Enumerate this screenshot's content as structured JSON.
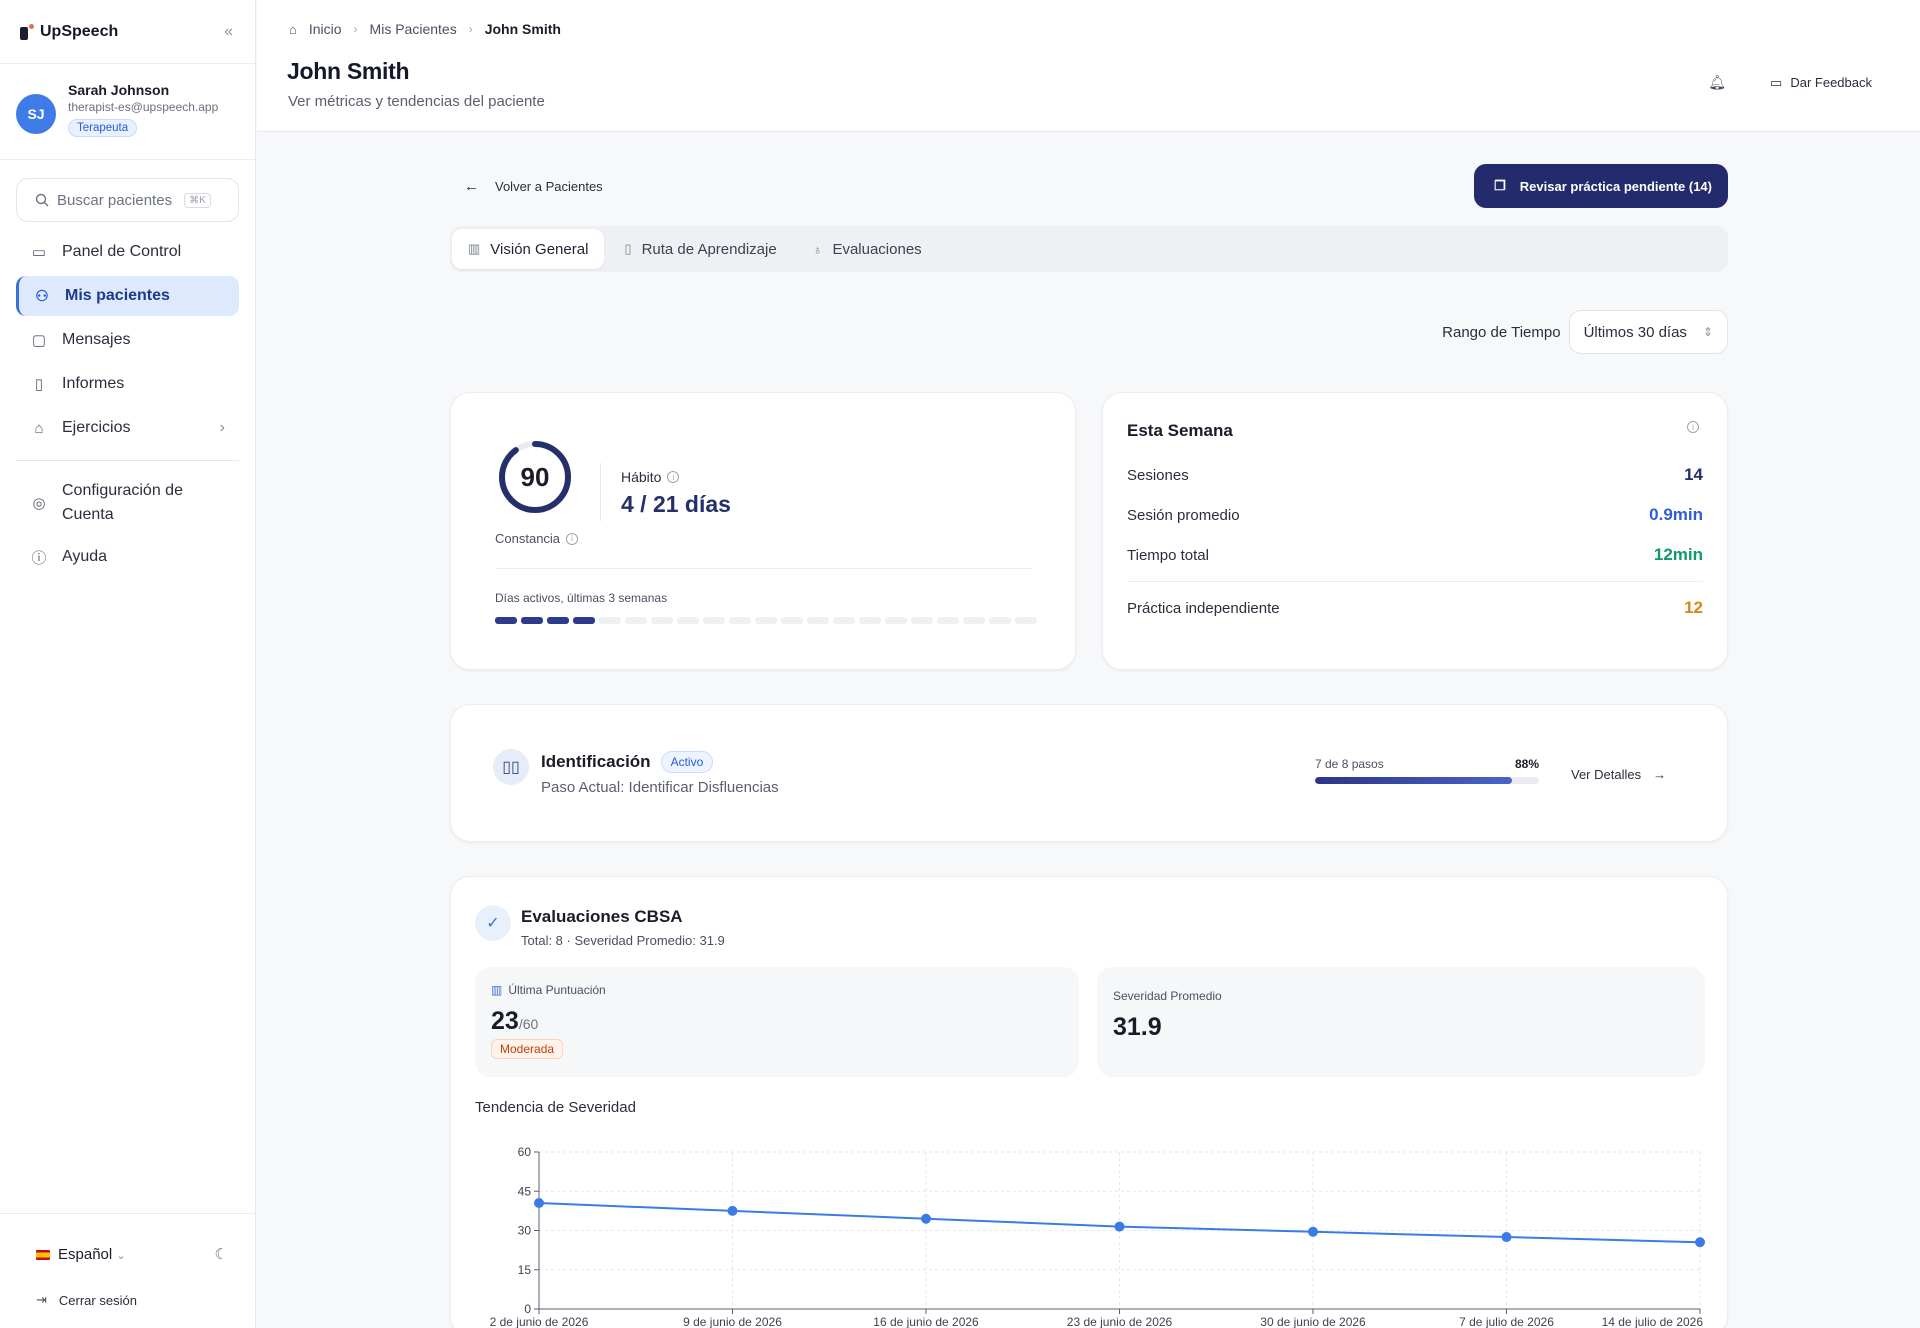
{
  "app": {
    "name": "UpSpeech"
  },
  "user": {
    "initials": "SJ",
    "name": "Sarah Johnson",
    "email": "therapist-es@upspeech.app",
    "role": "Terapeuta"
  },
  "search": {
    "placeholder": "Buscar pacientes",
    "shortcut": "⌘K"
  },
  "sidebar": {
    "items": [
      {
        "label": "Panel de Control",
        "icon": "dashboard-icon"
      },
      {
        "label": "Mis pacientes",
        "icon": "users-icon"
      },
      {
        "label": "Mensajes",
        "icon": "messages-icon"
      },
      {
        "label": "Informes",
        "icon": "report-icon"
      },
      {
        "label": "Ejercicios",
        "icon": "graduation-icon"
      }
    ],
    "secondary": [
      {
        "label": "Configuración de Cuenta",
        "icon": "user-circle-icon"
      },
      {
        "label": "Ayuda",
        "icon": "help-icon"
      }
    ],
    "language": "Español",
    "logout": "Cerrar sesión"
  },
  "header": {
    "breadcrumb": [
      "Inicio",
      "Mis Pacientes",
      "John Smith"
    ],
    "title": "John Smith",
    "subtitle": "Ver métricas y tendencias del paciente",
    "feedback": "Dar Feedback"
  },
  "main": {
    "back": "Volver a Pacientes",
    "review_button": "Revisar práctica pendiente (14)",
    "tabs": [
      "Visión General",
      "Ruta de Aprendizaje",
      "Evaluaciones"
    ],
    "range_label": "Rango de Tiempo",
    "range_value": "Últimos 30 días"
  },
  "habit": {
    "consistency": 90,
    "consistency_label": "Constancia",
    "habit_label": "Hábito",
    "habit_value": "4 / 21 días",
    "active_days_label": "Días activos, últimas 3 semanas",
    "active_days": 4,
    "total_days": 21
  },
  "week": {
    "title": "Esta Semana",
    "rows": [
      {
        "label": "Sesiones",
        "value": "14",
        "color": "#25306b"
      },
      {
        "label": "Sesión promedio",
        "value": "0.9min",
        "color": "#2f5fd0"
      },
      {
        "label": "Tiempo total",
        "value": "12min",
        "color": "#0f9a6a"
      }
    ],
    "independent": {
      "label": "Práctica independiente",
      "value": "12",
      "color": "#d98613"
    }
  },
  "path": {
    "title": "Identificación",
    "status": "Activo",
    "current_step": "Paso Actual: Identificar Disfluencias",
    "steps_label": "7 de 8 pasos",
    "percent": "88%",
    "progress": 0.88,
    "details": "Ver Detalles"
  },
  "cbsa": {
    "title": "Evaluaciones CBSA",
    "subtitle": "Total: 8 · Severidad Promedio: 31.9",
    "last_label": "Última Puntuación",
    "last_value": "23",
    "last_max": "/60",
    "severity": "Moderada",
    "avg_label": "Severidad Promedio",
    "avg_value": "31.9",
    "trend_title": "Tendencia de Severidad"
  },
  "chart_data": {
    "type": "line",
    "x": [
      "2 de junio de 2026",
      "9 de junio de 2026",
      "16 de junio de 2026",
      "23 de junio de 2026",
      "30 de junio de 2026",
      "7 de julio de 2026",
      "14 de julio de 2026"
    ],
    "series": [
      {
        "values": [
          40.5,
          37.5,
          34.5,
          31.5,
          29.5,
          27.5,
          25.5
        ]
      }
    ],
    "ylim": [
      0,
      60
    ],
    "yticks": [
      0,
      15,
      30,
      45,
      60
    ],
    "grid": true,
    "color": "#3b7be6"
  }
}
